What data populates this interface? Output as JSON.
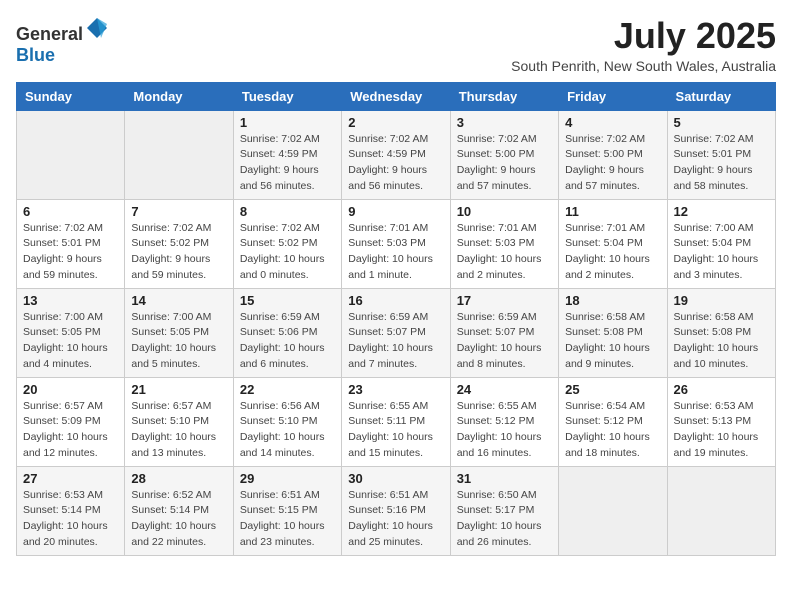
{
  "header": {
    "logo_general": "General",
    "logo_blue": "Blue",
    "month_year": "July 2025",
    "location": "South Penrith, New South Wales, Australia"
  },
  "days_of_week": [
    "Sunday",
    "Monday",
    "Tuesday",
    "Wednesday",
    "Thursday",
    "Friday",
    "Saturday"
  ],
  "weeks": [
    [
      {
        "day": "",
        "sunrise": "",
        "sunset": "",
        "daylight": ""
      },
      {
        "day": "",
        "sunrise": "",
        "sunset": "",
        "daylight": ""
      },
      {
        "day": "1",
        "sunrise": "Sunrise: 7:02 AM",
        "sunset": "Sunset: 4:59 PM",
        "daylight": "Daylight: 9 hours and 56 minutes."
      },
      {
        "day": "2",
        "sunrise": "Sunrise: 7:02 AM",
        "sunset": "Sunset: 4:59 PM",
        "daylight": "Daylight: 9 hours and 56 minutes."
      },
      {
        "day": "3",
        "sunrise": "Sunrise: 7:02 AM",
        "sunset": "Sunset: 5:00 PM",
        "daylight": "Daylight: 9 hours and 57 minutes."
      },
      {
        "day": "4",
        "sunrise": "Sunrise: 7:02 AM",
        "sunset": "Sunset: 5:00 PM",
        "daylight": "Daylight: 9 hours and 57 minutes."
      },
      {
        "day": "5",
        "sunrise": "Sunrise: 7:02 AM",
        "sunset": "Sunset: 5:01 PM",
        "daylight": "Daylight: 9 hours and 58 minutes."
      }
    ],
    [
      {
        "day": "6",
        "sunrise": "Sunrise: 7:02 AM",
        "sunset": "Sunset: 5:01 PM",
        "daylight": "Daylight: 9 hours and 59 minutes."
      },
      {
        "day": "7",
        "sunrise": "Sunrise: 7:02 AM",
        "sunset": "Sunset: 5:02 PM",
        "daylight": "Daylight: 9 hours and 59 minutes."
      },
      {
        "day": "8",
        "sunrise": "Sunrise: 7:02 AM",
        "sunset": "Sunset: 5:02 PM",
        "daylight": "Daylight: 10 hours and 0 minutes."
      },
      {
        "day": "9",
        "sunrise": "Sunrise: 7:01 AM",
        "sunset": "Sunset: 5:03 PM",
        "daylight": "Daylight: 10 hours and 1 minute."
      },
      {
        "day": "10",
        "sunrise": "Sunrise: 7:01 AM",
        "sunset": "Sunset: 5:03 PM",
        "daylight": "Daylight: 10 hours and 2 minutes."
      },
      {
        "day": "11",
        "sunrise": "Sunrise: 7:01 AM",
        "sunset": "Sunset: 5:04 PM",
        "daylight": "Daylight: 10 hours and 2 minutes."
      },
      {
        "day": "12",
        "sunrise": "Sunrise: 7:00 AM",
        "sunset": "Sunset: 5:04 PM",
        "daylight": "Daylight: 10 hours and 3 minutes."
      }
    ],
    [
      {
        "day": "13",
        "sunrise": "Sunrise: 7:00 AM",
        "sunset": "Sunset: 5:05 PM",
        "daylight": "Daylight: 10 hours and 4 minutes."
      },
      {
        "day": "14",
        "sunrise": "Sunrise: 7:00 AM",
        "sunset": "Sunset: 5:05 PM",
        "daylight": "Daylight: 10 hours and 5 minutes."
      },
      {
        "day": "15",
        "sunrise": "Sunrise: 6:59 AM",
        "sunset": "Sunset: 5:06 PM",
        "daylight": "Daylight: 10 hours and 6 minutes."
      },
      {
        "day": "16",
        "sunrise": "Sunrise: 6:59 AM",
        "sunset": "Sunset: 5:07 PM",
        "daylight": "Daylight: 10 hours and 7 minutes."
      },
      {
        "day": "17",
        "sunrise": "Sunrise: 6:59 AM",
        "sunset": "Sunset: 5:07 PM",
        "daylight": "Daylight: 10 hours and 8 minutes."
      },
      {
        "day": "18",
        "sunrise": "Sunrise: 6:58 AM",
        "sunset": "Sunset: 5:08 PM",
        "daylight": "Daylight: 10 hours and 9 minutes."
      },
      {
        "day": "19",
        "sunrise": "Sunrise: 6:58 AM",
        "sunset": "Sunset: 5:08 PM",
        "daylight": "Daylight: 10 hours and 10 minutes."
      }
    ],
    [
      {
        "day": "20",
        "sunrise": "Sunrise: 6:57 AM",
        "sunset": "Sunset: 5:09 PM",
        "daylight": "Daylight: 10 hours and 12 minutes."
      },
      {
        "day": "21",
        "sunrise": "Sunrise: 6:57 AM",
        "sunset": "Sunset: 5:10 PM",
        "daylight": "Daylight: 10 hours and 13 minutes."
      },
      {
        "day": "22",
        "sunrise": "Sunrise: 6:56 AM",
        "sunset": "Sunset: 5:10 PM",
        "daylight": "Daylight: 10 hours and 14 minutes."
      },
      {
        "day": "23",
        "sunrise": "Sunrise: 6:55 AM",
        "sunset": "Sunset: 5:11 PM",
        "daylight": "Daylight: 10 hours and 15 minutes."
      },
      {
        "day": "24",
        "sunrise": "Sunrise: 6:55 AM",
        "sunset": "Sunset: 5:12 PM",
        "daylight": "Daylight: 10 hours and 16 minutes."
      },
      {
        "day": "25",
        "sunrise": "Sunrise: 6:54 AM",
        "sunset": "Sunset: 5:12 PM",
        "daylight": "Daylight: 10 hours and 18 minutes."
      },
      {
        "day": "26",
        "sunrise": "Sunrise: 6:53 AM",
        "sunset": "Sunset: 5:13 PM",
        "daylight": "Daylight: 10 hours and 19 minutes."
      }
    ],
    [
      {
        "day": "27",
        "sunrise": "Sunrise: 6:53 AM",
        "sunset": "Sunset: 5:14 PM",
        "daylight": "Daylight: 10 hours and 20 minutes."
      },
      {
        "day": "28",
        "sunrise": "Sunrise: 6:52 AM",
        "sunset": "Sunset: 5:14 PM",
        "daylight": "Daylight: 10 hours and 22 minutes."
      },
      {
        "day": "29",
        "sunrise": "Sunrise: 6:51 AM",
        "sunset": "Sunset: 5:15 PM",
        "daylight": "Daylight: 10 hours and 23 minutes."
      },
      {
        "day": "30",
        "sunrise": "Sunrise: 6:51 AM",
        "sunset": "Sunset: 5:16 PM",
        "daylight": "Daylight: 10 hours and 25 minutes."
      },
      {
        "day": "31",
        "sunrise": "Sunrise: 6:50 AM",
        "sunset": "Sunset: 5:17 PM",
        "daylight": "Daylight: 10 hours and 26 minutes."
      },
      {
        "day": "",
        "sunrise": "",
        "sunset": "",
        "daylight": ""
      },
      {
        "day": "",
        "sunrise": "",
        "sunset": "",
        "daylight": ""
      }
    ]
  ]
}
